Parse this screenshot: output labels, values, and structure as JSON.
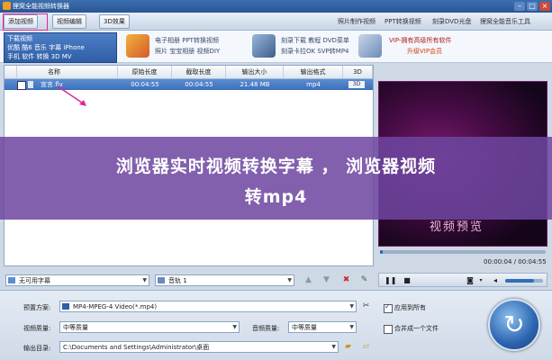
{
  "window": {
    "title": "狸窝全能视频转换器"
  },
  "toolbar": {
    "add_video": "添加视频",
    "edit_video": "视频编辑",
    "effect_3d": "3D效果",
    "links": [
      "照片制作视频",
      "PPT转换视频",
      "刻录DVD光盘",
      "狸窝全能音乐工具"
    ]
  },
  "promo": {
    "download_header": "下载视频",
    "download_rows": [
      "优酷 酷6 音乐 字幕 iPhone",
      "手机 软件 转换 3D MV"
    ],
    "items": [
      {
        "line1": "电子相册 PPT转换视频",
        "line2": "照片 宝宝相册 视频DIY"
      },
      {
        "line1": "刻录下载 教程 DVD菜单",
        "line2": "刻录卡拉OK SVP转MP4"
      },
      {
        "line1": "VIP-拥有高级所有软件",
        "line2": "升级VIP会员"
      }
    ]
  },
  "table": {
    "headers": [
      "名称",
      "原始长度",
      "截取长度",
      "输出大小",
      "输出格式",
      "3D"
    ],
    "rows": [
      {
        "name": "宣言.flv",
        "original": "00:04:55",
        "clip": "00:04:55",
        "size": "21.48 MB",
        "format": "mp4",
        "three_d": "3D"
      }
    ]
  },
  "player": {
    "video_title": "视频预览",
    "time": "00:00:04 / 00:04:55",
    "progress": 0.014,
    "volume": 0.75
  },
  "subtitle": {
    "value": "无可用字幕"
  },
  "audio": {
    "value": "音轨 1"
  },
  "settings": {
    "preset_label": "预置方案:",
    "preset_value": "MP4-MPEG-4 Video(*.mp4)",
    "video_quality_label": "视频质量:",
    "video_quality_value": "中等质量",
    "audio_quality_label": "音频质量:",
    "audio_quality_value": "中等质量",
    "output_label": "输出目录:",
    "output_value": "C:\\Documents and Settings\\Administrator\\桌面",
    "apply_all": "应用到所有",
    "merge": "合并成一个文件",
    "apply_all_checked": true,
    "merge_checked": false
  },
  "banner": {
    "line1": "浏览器实时视频转换字幕 ， 浏览器视频",
    "line2": "转mp4"
  },
  "colors": {
    "accent": "#3b6fb8",
    "banner": "#6e46a0",
    "highlight": "#e0249c"
  }
}
